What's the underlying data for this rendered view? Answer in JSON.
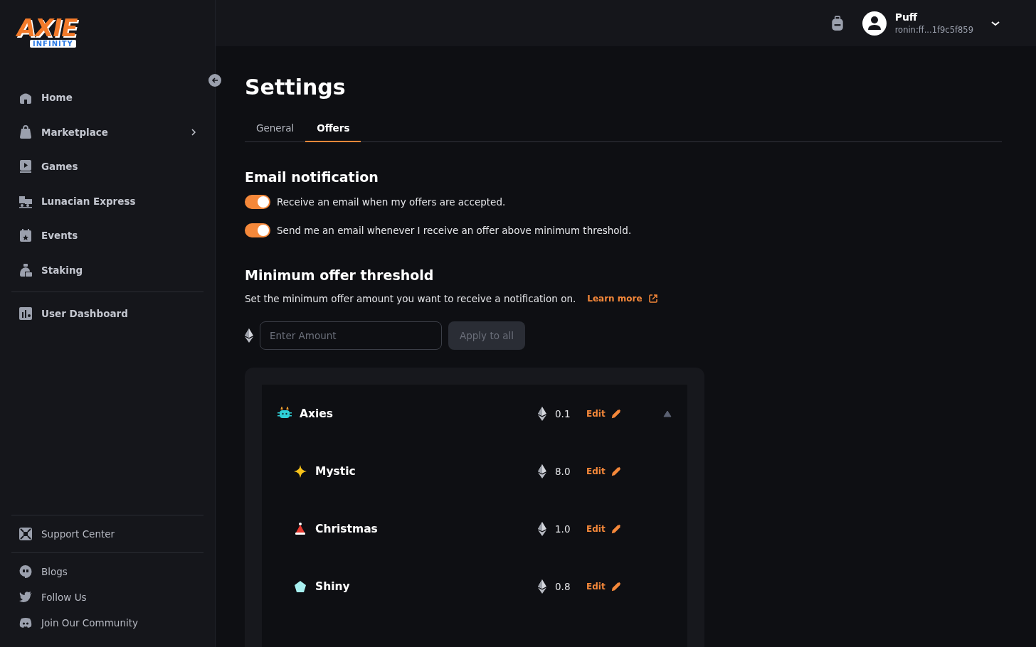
{
  "logo": {
    "title": "AXIE",
    "subtitle": "INFINITY"
  },
  "sidebar": {
    "main_items": [
      {
        "kind": "home",
        "label": "Home",
        "has_submenu": false
      },
      {
        "kind": "bag",
        "label": "Marketplace",
        "has_submenu": true
      },
      {
        "kind": "games",
        "label": "Games",
        "has_submenu": false
      },
      {
        "kind": "train",
        "label": "Lunacian Express",
        "has_submenu": false
      },
      {
        "kind": "calendar",
        "label": "Events",
        "has_submenu": false
      },
      {
        "kind": "staking",
        "label": "Staking",
        "has_submenu": false
      }
    ],
    "dashboard_items": [
      {
        "kind": "dashboard",
        "label": "User Dashboard",
        "has_submenu": false
      }
    ],
    "support_items": [
      {
        "kind": "support",
        "label": "Support Center"
      }
    ],
    "social_items": [
      {
        "kind": "blog",
        "label": "Blogs"
      },
      {
        "kind": "bird",
        "label": "Follow Us"
      },
      {
        "kind": "chat",
        "label": "Join Our Community"
      }
    ]
  },
  "user": {
    "name": "Puff",
    "address": "ronin:ff...1f9c5f859"
  },
  "page_title": "Settings",
  "tabs": [
    {
      "label": "General",
      "selected": false
    },
    {
      "label": "Offers",
      "selected": true
    }
  ],
  "email_section": {
    "title": "Email notification",
    "toggles": [
      {
        "label": "Receive an email when my offers are accepted.",
        "on": true
      },
      {
        "label": "Send me an email whenever I receive an offer above minimum threshold.",
        "on": true
      }
    ]
  },
  "threshold_section": {
    "title": "Minimum offer threshold",
    "description": "Set the minimum offer amount you want to receive a notification on.",
    "link": "Learn more",
    "amount_field": {
      "placeholder": "Enter Amount"
    },
    "apply_button": {
      "label": "Apply to all",
      "disabled": true
    }
  },
  "offer_rows": [
    {
      "kind": "parent",
      "name": "Axies",
      "amount": "0.1",
      "action": "Edit",
      "expanded": true
    },
    {
      "kind": "child",
      "name": "Mystic",
      "amount": "8.0",
      "action": "Edit"
    },
    {
      "kind": "child",
      "name": "Christmas",
      "amount": "1.0",
      "action": "Edit"
    },
    {
      "kind": "child",
      "name": "Shiny",
      "amount": "0.8",
      "action": "Edit"
    }
  ]
}
